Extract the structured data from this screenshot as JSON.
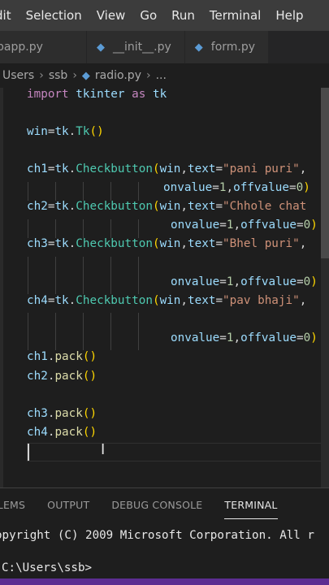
{
  "menu": [
    "dit",
    "Selection",
    "View",
    "Go",
    "Run",
    "Terminal",
    "Help"
  ],
  "tabs": [
    {
      "label": "bapp.py",
      "icon": null
    },
    {
      "label": "__init__.py",
      "icon": "python-file-icon"
    },
    {
      "label": "form.py",
      "icon": "python-file-icon"
    }
  ],
  "breadcrumb": {
    "parts": [
      "Users",
      "ssb"
    ],
    "file": "radio.py",
    "tail": "..."
  },
  "editor": {
    "line_import": [
      "import",
      "tkinter",
      "as",
      "tk"
    ],
    "line_win": [
      "win",
      "=",
      "tk",
      ".",
      "Tk",
      "(",
      ")"
    ],
    "ch1_a": [
      "ch1",
      "=",
      "tk",
      ".",
      "Checkbutton",
      "(",
      "win",
      ",",
      "text",
      "=",
      "\"pani puri\"",
      ","
    ],
    "ch1_b": [
      "onvalue",
      "=",
      "1",
      ",",
      "offvalue",
      "=",
      "0",
      ")"
    ],
    "ch2_a": [
      "ch2",
      "=",
      "tk",
      ".",
      "Checkbutton",
      "(",
      "win",
      ",",
      "text",
      "=",
      "\"Chhole chat"
    ],
    "ch2_b": [
      "onvalue",
      "=",
      "1",
      ",",
      "offvalue",
      "=",
      "0",
      ")"
    ],
    "ch3_a": [
      "ch3",
      "=",
      "tk",
      ".",
      "Checkbutton",
      "(",
      "win",
      ",",
      "text",
      "=",
      "\"Bhel puri\"",
      ","
    ],
    "ch3_b": [
      "onvalue",
      "=",
      "1",
      ",",
      "offvalue",
      "=",
      "0",
      ")"
    ],
    "ch4_a": [
      "ch4",
      "=",
      "tk",
      ".",
      "Checkbutton",
      "(",
      "win",
      ",",
      "text",
      "=",
      "\"pav bhaji\"",
      ","
    ],
    "ch4_b": [
      "onvalue",
      "=",
      "1",
      ",",
      "offvalue",
      "=",
      "0",
      ")"
    ],
    "pack1": [
      "ch1",
      ".",
      "pack",
      "()"
    ],
    "pack2": [
      "ch2",
      ".",
      "pack",
      "()"
    ],
    "pack3": [
      "ch3",
      ".",
      "pack",
      "()"
    ],
    "pack4": [
      "ch4",
      ".",
      "pack",
      "()"
    ]
  },
  "panel": {
    "tabs": [
      "BLEMS",
      "OUTPUT",
      "DEBUG CONSOLE",
      "TERMINAL"
    ],
    "active_tab": "TERMINAL",
    "terminal_lines": [
      "opyright (C) 2009 Microsoft Corporation. All r",
      "C:\\Users\\ssb>"
    ]
  },
  "colors": {
    "keyword": "#c586c0",
    "variable": "#9cdcfe",
    "class": "#4ec9b0",
    "string": "#ce9178",
    "number": "#b5cea8",
    "statusbar": "#5c2d91"
  }
}
